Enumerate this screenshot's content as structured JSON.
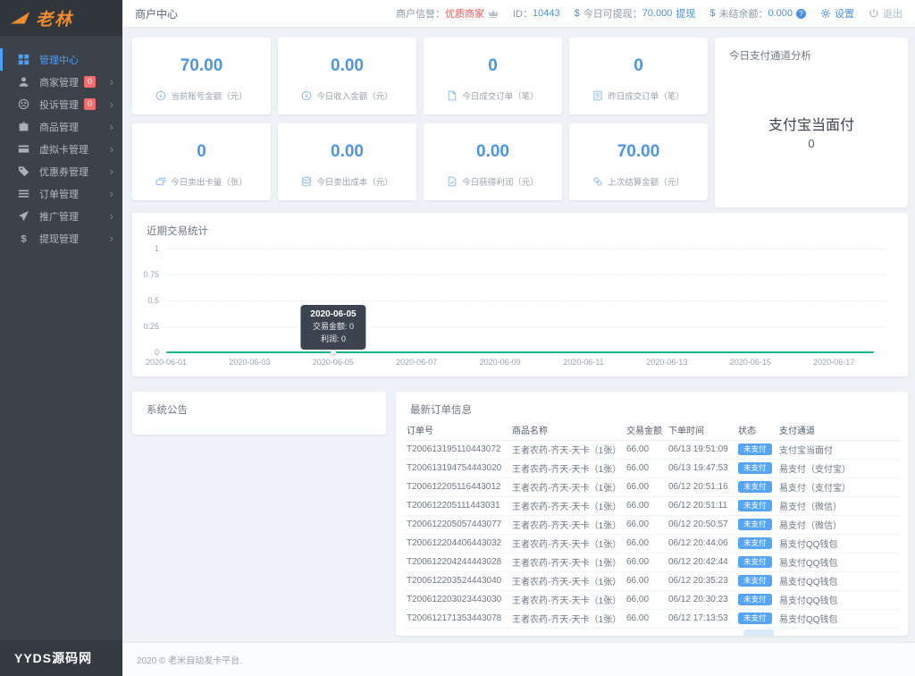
{
  "brand": {
    "logo_text": "老林",
    "bottom_text": "YYDS源码网"
  },
  "topbar": {
    "title": "商户中心",
    "reputation": {
      "label": "商户信誉：",
      "value": "优质商家"
    },
    "merchant_id": {
      "label": "ID：",
      "value": "10443"
    },
    "withdrawable": {
      "currency": "$",
      "label": "今日可提现：",
      "value": "70.000",
      "action": "提现"
    },
    "unsettled": {
      "currency": "$",
      "label": "未结余额：",
      "value": "0.000"
    },
    "settings_label": "设置",
    "logout_label": "退出"
  },
  "sidebar": {
    "items": [
      {
        "id": "dashboard",
        "icon": "dashboard-icon",
        "label": "管理中心",
        "active": true
      },
      {
        "id": "merchants",
        "icon": "user-icon",
        "label": "商家管理",
        "badge": "0",
        "arrow": true
      },
      {
        "id": "complaints",
        "icon": "complaint-icon",
        "label": "投诉管理",
        "badge": "0",
        "arrow": true
      },
      {
        "id": "products",
        "icon": "briefcase-icon",
        "label": "商品管理",
        "arrow": true
      },
      {
        "id": "virtual-cards",
        "icon": "credit-card-icon",
        "label": "虚拟卡管理",
        "arrow": true
      },
      {
        "id": "coupons",
        "icon": "tag-icon",
        "label": "优惠券管理",
        "arrow": true
      },
      {
        "id": "orders",
        "icon": "list-icon",
        "label": "订单管理",
        "arrow": true
      },
      {
        "id": "promotion",
        "icon": "paper-plane-icon",
        "label": "推广管理",
        "arrow": true
      },
      {
        "id": "withdrawals",
        "icon": "dollar-icon",
        "label": "提现管理",
        "arrow": true
      }
    ]
  },
  "stats": [
    {
      "icon": "coin-icon",
      "value": "70.00",
      "label": "当前账号金额（元）"
    },
    {
      "icon": "coin-icon",
      "value": "0.00",
      "label": "今日收入金额（元）"
    },
    {
      "icon": "file-icon",
      "value": "0",
      "label": "今日成交订单（笔）"
    },
    {
      "icon": "list-file-icon",
      "value": "0",
      "label": "昨日成交订单（笔）"
    },
    {
      "icon": "cards-icon",
      "value": "0",
      "label": "今日卖出卡量（张）"
    },
    {
      "icon": "database-icon",
      "value": "0.00",
      "label": "今日卖出成本（元）"
    },
    {
      "icon": "profit-icon",
      "value": "0.00",
      "label": "今日获得利润（元）"
    },
    {
      "icon": "settle-icon",
      "value": "70.00",
      "label": "上次结算金额（元）"
    }
  ],
  "channel_panel": {
    "title": "今日支付通道分析",
    "name": "支付宝当面付",
    "value": "0"
  },
  "chart_panel": {
    "title": "近期交易统计"
  },
  "chart_data": {
    "type": "line",
    "title": "近期交易统计",
    "x": [
      "2020-06-01",
      "2020-06-02",
      "2020-06-03",
      "2020-06-04",
      "2020-06-05",
      "2020-06-06",
      "2020-06-07",
      "2020-06-08",
      "2020-06-09",
      "2020-06-10",
      "2020-06-11",
      "2020-06-12",
      "2020-06-13",
      "2020-06-14",
      "2020-06-15",
      "2020-06-16",
      "2020-06-17"
    ],
    "x_tick_labels": [
      "2020-06-01",
      "2020-06-03",
      "2020-06-05",
      "2020-06-07",
      "2020-06-09",
      "2020-06-11",
      "2020-06-13",
      "2020-06-15",
      "2020-06-17"
    ],
    "yticks": [
      "0",
      "0.25",
      "0.5",
      "0.75",
      "1"
    ],
    "ylim": [
      0,
      1
    ],
    "grid": true,
    "legend_position": "none",
    "series": [
      {
        "name": "交易金额",
        "values": [
          0,
          0,
          0,
          0,
          0,
          0,
          0,
          0,
          0,
          0,
          0,
          0,
          0,
          0,
          0,
          0,
          0
        ]
      },
      {
        "name": "利润",
        "values": [
          0,
          0,
          0,
          0,
          0,
          0,
          0,
          0,
          0,
          0,
          0,
          0,
          0,
          0,
          0,
          0,
          0
        ]
      }
    ],
    "line_color": "#1ab394",
    "tooltip": {
      "title": "2020-06-05",
      "lines": [
        "交易金额: 0",
        "利润: 0"
      ],
      "x_index": 4
    }
  },
  "notice_panel": {
    "title": "系统公告"
  },
  "orders_panel": {
    "title": "最新订单信息",
    "columns": [
      "订单号",
      "商品名称",
      "交易金额",
      "下单时间",
      "状态",
      "支付通道"
    ],
    "rows": [
      {
        "order_no": "T200613195110443072",
        "product": "王者农药-齐天-天卡（1张）",
        "amount": "66.00",
        "time": "06/13 19:51:09",
        "status": "未支付",
        "channel": "支付宝当面付"
      },
      {
        "order_no": "T200613194754443020",
        "product": "王者农药-齐天-天卡（1张）",
        "amount": "66.00",
        "time": "06/13 19:47:53",
        "status": "未支付",
        "channel": "易支付（支付宝）"
      },
      {
        "order_no": "T200612205116443012",
        "product": "王者农药-齐天-天卡（1张）",
        "amount": "66.00",
        "time": "06/12 20:51:16",
        "status": "未支付",
        "channel": "易支付（支付宝）"
      },
      {
        "order_no": "T200612205111443031",
        "product": "王者农药-齐天-天卡（1张）",
        "amount": "66.00",
        "time": "06/12 20:51:11",
        "status": "未支付",
        "channel": "易支付（微信）"
      },
      {
        "order_no": "T200612205057443077",
        "product": "王者农药-齐天-天卡（1张）",
        "amount": "66.00",
        "time": "06/12 20:50:57",
        "status": "未支付",
        "channel": "易支付（微信）"
      },
      {
        "order_no": "T200612204406443032",
        "product": "王者农药-齐天-天卡（1张）",
        "amount": "66.00",
        "time": "06/12 20:44:06",
        "status": "未支付",
        "channel": "易支付QQ钱包"
      },
      {
        "order_no": "T200612204244443028",
        "product": "王者农药-齐天-天卡（1张）",
        "amount": "66.00",
        "time": "06/12 20:42:44",
        "status": "未支付",
        "channel": "易支付QQ钱包"
      },
      {
        "order_no": "T200612203524443040",
        "product": "王者农药-齐天-天卡（1张）",
        "amount": "66.00",
        "time": "06/12 20:35:23",
        "status": "未支付",
        "channel": "易支付QQ钱包"
      },
      {
        "order_no": "T200612203023443030",
        "product": "王者农药-齐天-天卡（1张）",
        "amount": "66.00",
        "time": "06/12 20:30:23",
        "status": "未支付",
        "channel": "易支付QQ钱包"
      },
      {
        "order_no": "T200612171353443078",
        "product": "王者农药-齐天-天卡（1张）",
        "amount": "66.00",
        "time": "06/12 17:13:53",
        "status": "未支付",
        "channel": "易支付QQ钱包"
      }
    ]
  },
  "footer": {
    "copyright": "2020 © 老米自动发卡平台."
  },
  "colors": {
    "accent_blue": "#4a90e2",
    "stat_blue": "#4e95e0",
    "badge_blue": "#56a5f5",
    "danger_red": "#f05858",
    "line_green": "#1ab394",
    "sidebar_bg": "#3b424a",
    "logo_orange": "#ee8c2e"
  }
}
